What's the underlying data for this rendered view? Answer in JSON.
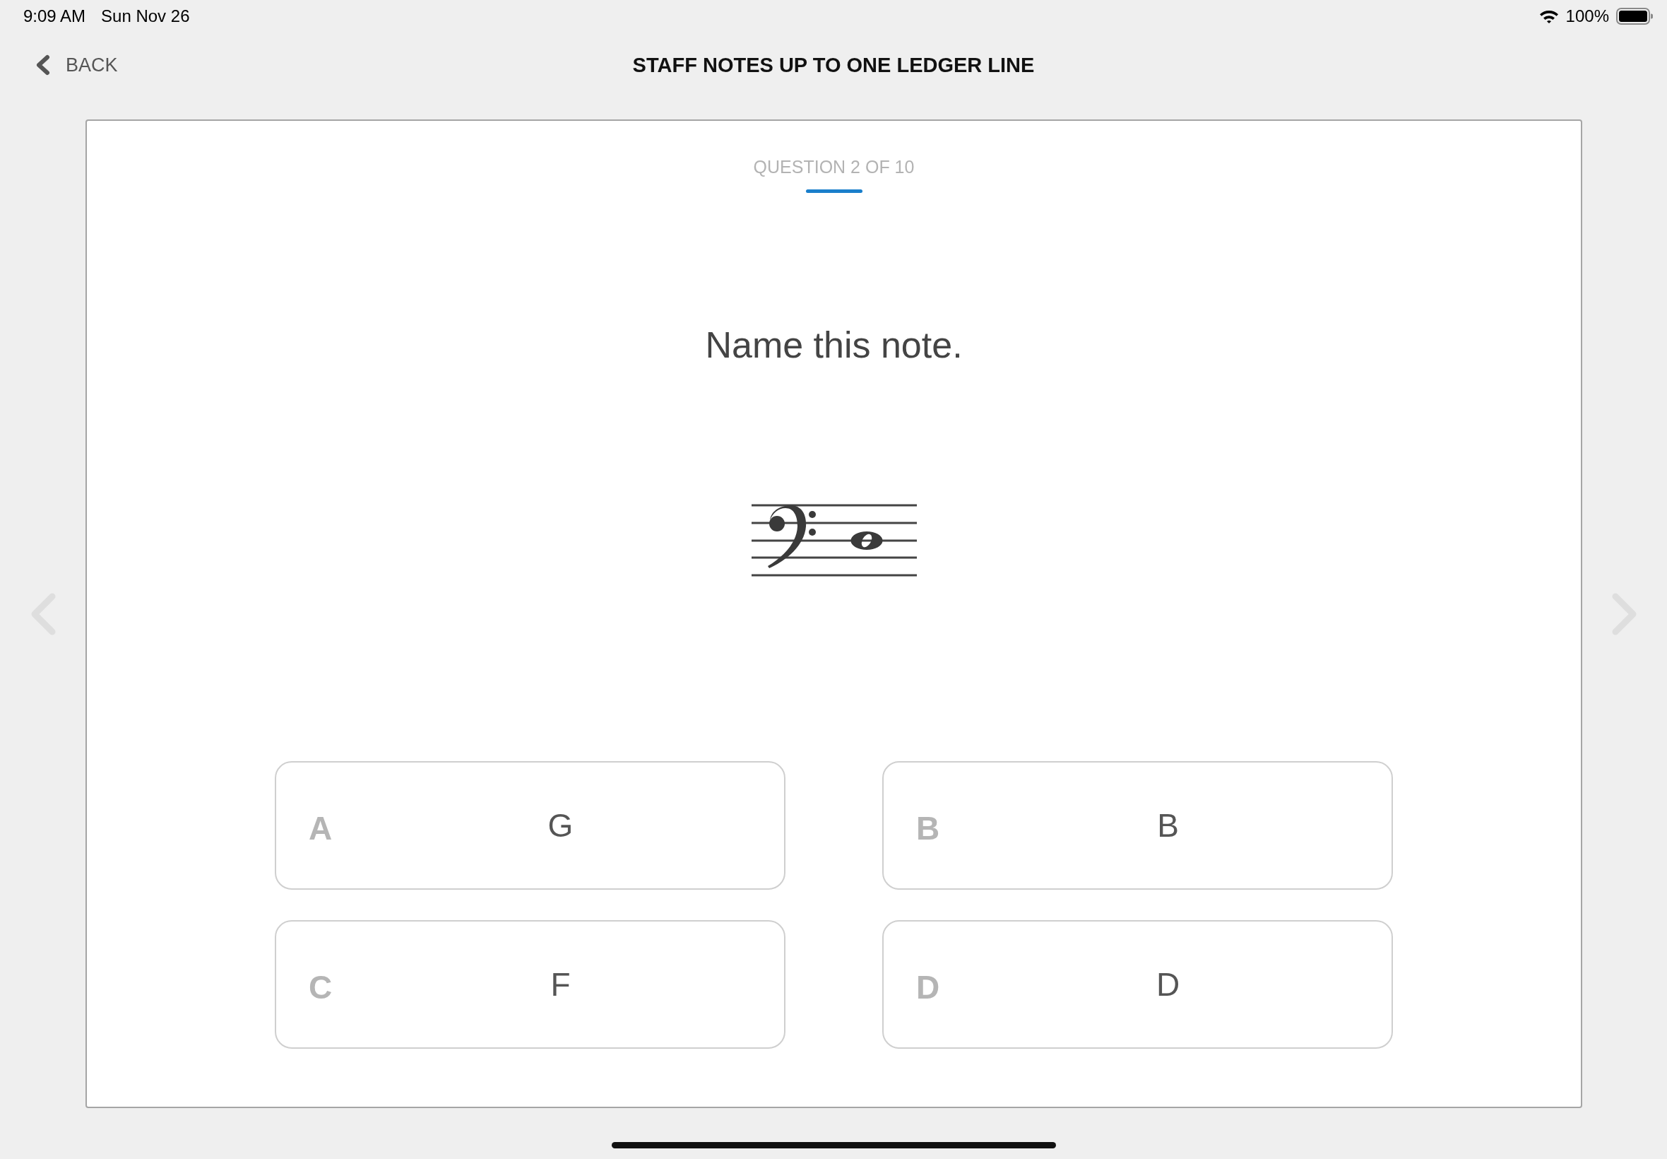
{
  "status_bar": {
    "time": "9:09 AM",
    "date": "Sun Nov 26",
    "battery": "100%"
  },
  "header": {
    "back": "BACK",
    "title": "STAFF NOTES UP TO ONE LEDGER LINE"
  },
  "question": {
    "counter": "QUESTION 2 OF 10",
    "prompt": "Name this note."
  },
  "answers": [
    {
      "letter": "A",
      "value": "G",
      "selected": false
    },
    {
      "letter": "B",
      "value": "B",
      "selected": false
    },
    {
      "letter": "C",
      "value": "F",
      "selected": false
    },
    {
      "letter": "D",
      "value": "D",
      "selected": false
    }
  ]
}
